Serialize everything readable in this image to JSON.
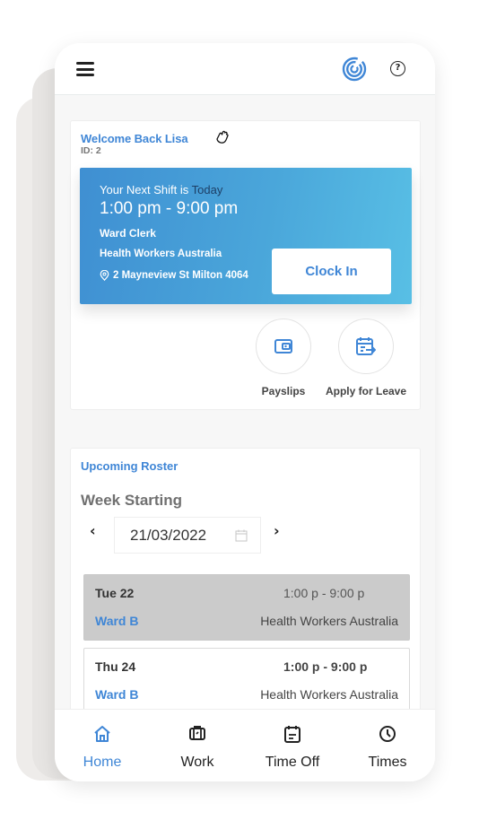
{
  "colors": {
    "accent": "#3f86d6",
    "shift_gradient_start": "#3f8fd2",
    "shift_gradient_end": "#58bfe5",
    "highlight_row": "#cbcbcb"
  },
  "topbar": {
    "menu_icon": "hamburger-menu-icon",
    "logo_icon": "spiral-logo-icon",
    "help_icon": "help-question-icon",
    "help_glyph": "?"
  },
  "welcome": {
    "title": "Welcome Back Lisa",
    "wave_icon": "waving-hand-icon",
    "id_label": "ID: 2"
  },
  "next_shift": {
    "heading_prefix": "Your Next Shift is",
    "heading_day": "Today",
    "time": "1:00 pm - 9:00 pm",
    "role": "Ward Clerk",
    "company": "Health Workers Australia",
    "address": "2 Mayneview St Milton 4064",
    "clock_in_label": "Clock In"
  },
  "quick_actions": [
    {
      "label": "Payslips",
      "icon": "wallet-icon"
    },
    {
      "label": "Apply for Leave",
      "icon": "calendar-leave-icon"
    }
  ],
  "roster": {
    "title": "Upcoming Roster",
    "week_label": "Week Starting",
    "prev_glyph": "‹",
    "next_glyph": "›",
    "week_start_date": "21/03/2022",
    "rows": [
      {
        "day": "Tue 22",
        "time": "1:00 p - 9:00 p",
        "ward": "Ward B",
        "company": "Health Workers Australia",
        "highlighted": true
      },
      {
        "day": "Thu 24",
        "time": "1:00 p - 9:00 p",
        "ward": "Ward B",
        "company": "Health Workers Australia",
        "highlighted": false
      }
    ]
  },
  "bottom_nav": [
    {
      "label": "Home",
      "icon": "home-icon",
      "active": true
    },
    {
      "label": "Work",
      "icon": "briefcase-icon",
      "active": false
    },
    {
      "label": "Time Off",
      "icon": "calendar-icon",
      "active": false
    },
    {
      "label": "Times",
      "icon": "clock-icon",
      "active": false
    }
  ]
}
